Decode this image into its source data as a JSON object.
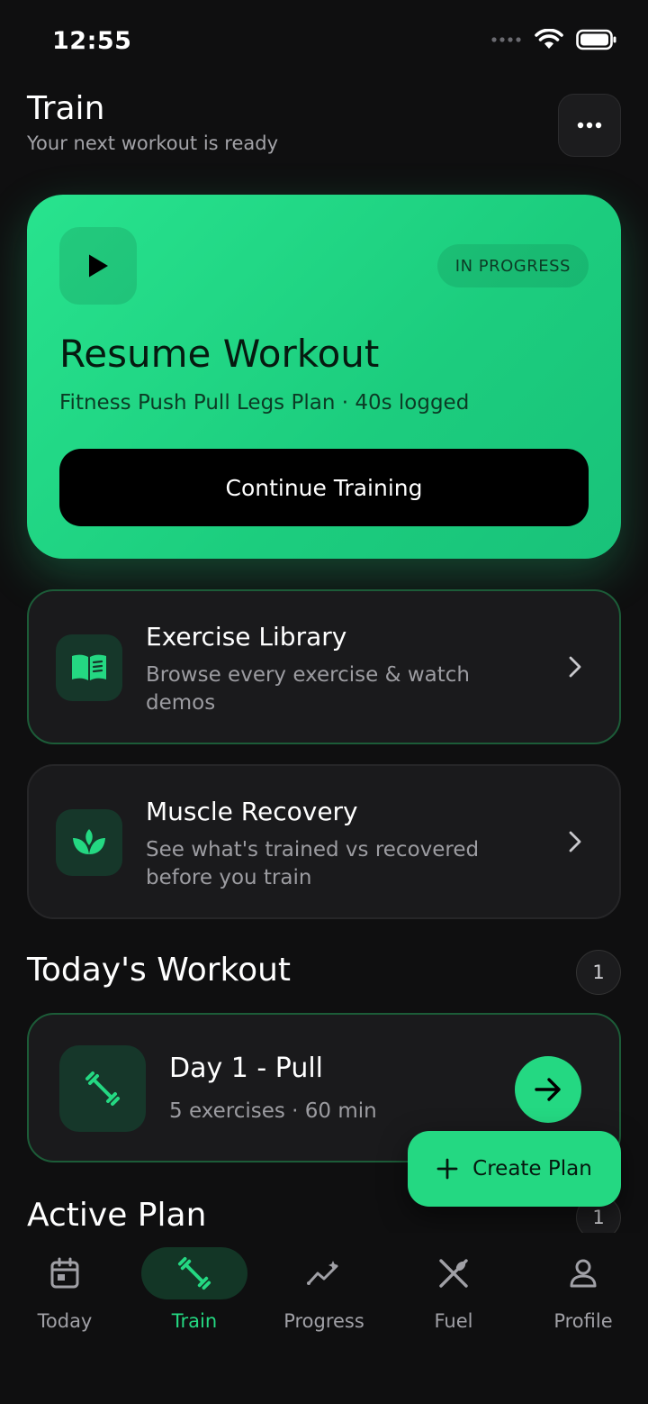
{
  "status_bar": {
    "time": "12:55"
  },
  "header": {
    "title": "Train",
    "subtitle": "Your next workout is ready",
    "more_icon": "more-horizontal-icon"
  },
  "resume_card": {
    "badge": "IN PROGRESS",
    "title": "Resume Workout",
    "subtitle": "Fitness Push Pull Legs Plan · 40s logged",
    "button_label": "Continue Training",
    "icon": "play-icon",
    "accent_color": "#24d882"
  },
  "nav_cards": [
    {
      "title": "Exercise Library",
      "description": "Browse every exercise & watch demos",
      "icon": "book-icon"
    },
    {
      "title": "Muscle Recovery",
      "description": "See what's trained vs recovered before you train",
      "icon": "leaf-icon"
    }
  ],
  "todays_workout": {
    "title": "Today's Workout",
    "count": "1",
    "items": [
      {
        "name": "Day 1 - Pull",
        "meta": "5 exercises · 60 min",
        "icon": "dumbbell-icon"
      }
    ]
  },
  "active_plan": {
    "title": "Active Plan",
    "count": "1"
  },
  "fab": {
    "label": "Create Plan",
    "icon": "plus-icon"
  },
  "tabs": [
    {
      "label": "Today",
      "icon": "calendar-icon",
      "active": false
    },
    {
      "label": "Train",
      "icon": "dumbbell-icon",
      "active": true
    },
    {
      "label": "Progress",
      "icon": "trend-icon",
      "active": false
    },
    {
      "label": "Fuel",
      "icon": "utensils-icon",
      "active": false
    },
    {
      "label": "Profile",
      "icon": "user-icon",
      "active": false
    }
  ]
}
